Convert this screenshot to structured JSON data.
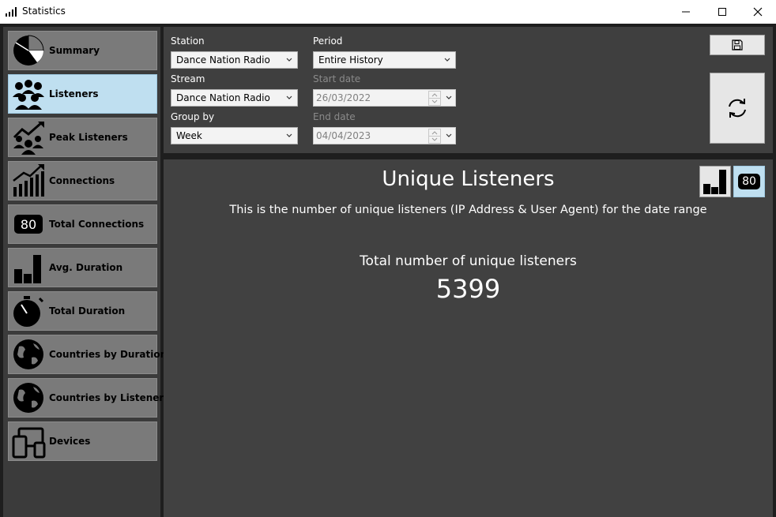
{
  "window": {
    "title": "Statistics"
  },
  "sidebar": {
    "items": [
      {
        "label": "Summary",
        "icon": "pie-chart-icon"
      },
      {
        "label": "Listeners",
        "icon": "people-group-icon",
        "selected": true
      },
      {
        "label": "Peak Listeners",
        "icon": "peak-people-icon"
      },
      {
        "label": "Connections",
        "icon": "rising-bars-icon"
      },
      {
        "label": "Total Connections",
        "icon": "number-badge-icon",
        "badge": "80"
      },
      {
        "label": "Avg. Duration",
        "icon": "bar-chart-icon"
      },
      {
        "label": "Total Duration",
        "icon": "stopwatch-icon"
      },
      {
        "label": "Countries by Duration",
        "icon": "globe-icon"
      },
      {
        "label": "Countries by Listeners",
        "icon": "globe-icon"
      },
      {
        "label": "Devices",
        "icon": "devices-icon"
      }
    ]
  },
  "filters": {
    "station": {
      "label": "Station",
      "value": "Dance Nation Radio"
    },
    "stream": {
      "label": "Stream",
      "value": "Dance Nation Radio"
    },
    "group_by": {
      "label": "Group by",
      "value": "Week"
    },
    "period": {
      "label": "Period",
      "value": "Entire History"
    },
    "start_date": {
      "label": "Start date",
      "value": "26/03/2022"
    },
    "end_date": {
      "label": "End date",
      "value": "04/04/2023"
    }
  },
  "main": {
    "title": "Unique Listeners",
    "description": "This is the number of unique listeners (IP Address & User Agent) for the date range",
    "total_label": "Total number of unique listeners",
    "total_value": "5399",
    "number_view_badge": "80"
  },
  "colors": {
    "selected_bg": "#bfdff0",
    "nav_bg": "#7a7a7a",
    "panel_bg": "#414141"
  }
}
